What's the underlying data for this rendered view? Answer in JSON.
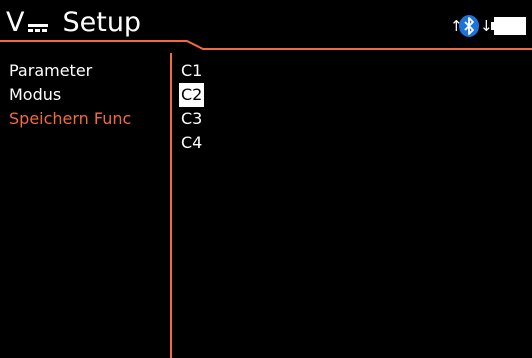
{
  "header": {
    "title": "Setup",
    "mode_letter": "V"
  },
  "status": {
    "up_arrow": "↑",
    "down_arrow": "↓",
    "icons": [
      "upload-arrow-icon",
      "bluetooth-icon",
      "download-arrow-icon",
      "battery-icon"
    ],
    "battery_level": 1.0
  },
  "menu": {
    "items": [
      {
        "label": "Parameter"
      },
      {
        "label": "Modus"
      },
      {
        "label": "Speichern Func",
        "active": true
      }
    ]
  },
  "options": {
    "items": [
      {
        "label": "C1"
      },
      {
        "label": "C2",
        "selected": true
      },
      {
        "label": "C3"
      },
      {
        "label": "C4"
      }
    ]
  },
  "colors": {
    "background": "#000000",
    "accent": "#f26a3f",
    "text": "#ffffff",
    "bluetooth": "#1e73d9"
  }
}
